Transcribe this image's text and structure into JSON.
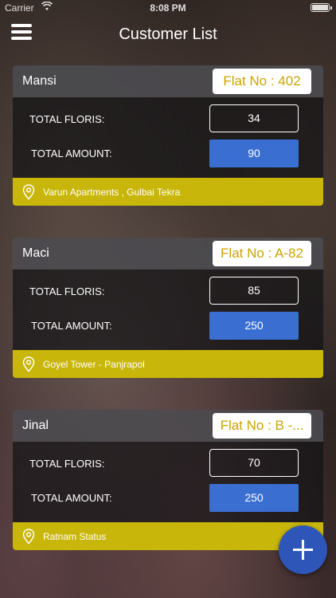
{
  "status_bar": {
    "carrier": "Carrier",
    "time": "8:08 PM"
  },
  "header": {
    "title": "Customer List",
    "menu_icon": "hamburger-menu-icon"
  },
  "labels": {
    "total_floris": "TOTAL FLORIS:",
    "total_amount": "TOTAL AMOUNT:"
  },
  "customers": [
    {
      "name": "Mansi",
      "flat": "Flat No : 402",
      "floris": "34",
      "amount": "90",
      "address": "Varun Apartments , Gulbai Tekra"
    },
    {
      "name": "Maci",
      "flat": "Flat No : A-82",
      "floris": "85",
      "amount": "250",
      "address": "Goyel Tower - Panjrapol"
    },
    {
      "name": "Jinal",
      "flat": "Flat No : B -...",
      "floris": "70",
      "amount": "250",
      "address": "Ratnam Status"
    }
  ],
  "fab": {
    "icon": "plus-icon",
    "color": "#2e56b8"
  },
  "colors": {
    "accent_yellow": "#c9b60a",
    "amount_blue": "#3a6fd1",
    "flat_text": "#c9a400"
  }
}
